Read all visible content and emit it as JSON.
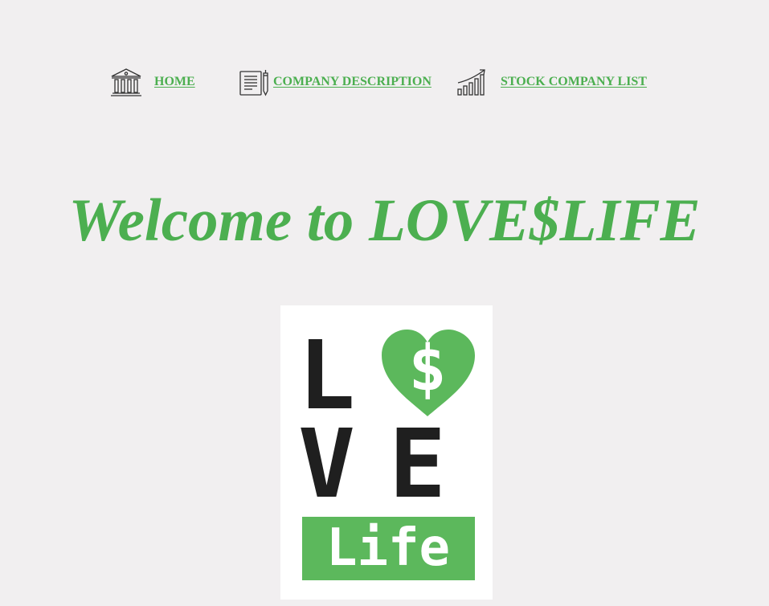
{
  "nav": {
    "items": [
      {
        "label": "HOME",
        "icon": "bank-icon"
      },
      {
        "label": "COMPANY DESCRIPTION",
        "icon": "document-pen-icon"
      },
      {
        "label": "STOCK COMPANY LIST",
        "icon": "growth-chart-icon"
      }
    ]
  },
  "hero": {
    "title": "Welcome to LOVE$LIFE"
  },
  "logo": {
    "letter_l": "L",
    "dollar": "$",
    "letter_v": "V",
    "letter_e": "E",
    "word": "Life",
    "accent_color": "#5cb85c",
    "ink_color": "#1f1f1f"
  },
  "colors": {
    "brand_green": "#4caf50",
    "background": "#f1eff0"
  }
}
